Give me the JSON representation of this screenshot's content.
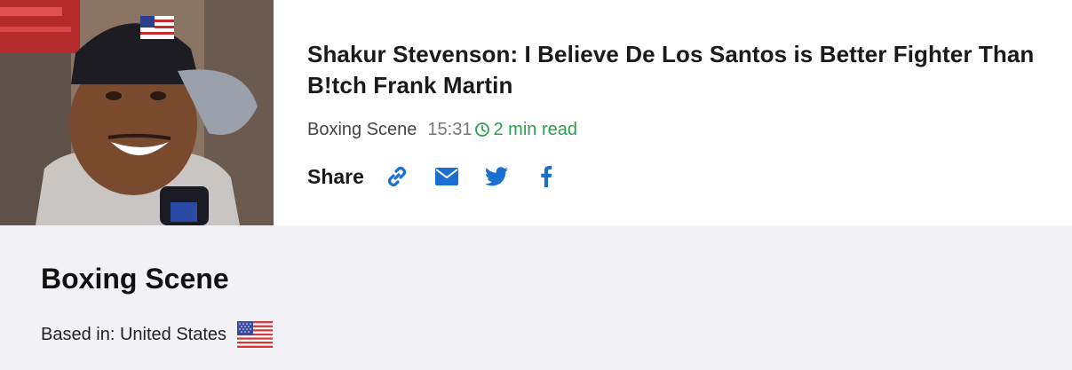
{
  "article": {
    "image_alt": "Shakur Stevenson smiling at a press conference",
    "headline": "Shakur Stevenson: I Believe De Los Santos is Better Fighter Than B!tch Frank Martin",
    "source": "Boxing Scene",
    "time": "15:31",
    "read_time": "2 min read",
    "read_time_color": "#2e9e4a",
    "share_label": "Share",
    "share_icons": [
      "link-icon",
      "mail-icon",
      "twitter-icon",
      "facebook-icon"
    ],
    "accent_color": "#1a6fd1"
  },
  "publisher": {
    "name": "Boxing Scene",
    "based_in": "Based in: United States",
    "country_flag": "us-flag-icon",
    "background": "#f2f1f5"
  }
}
